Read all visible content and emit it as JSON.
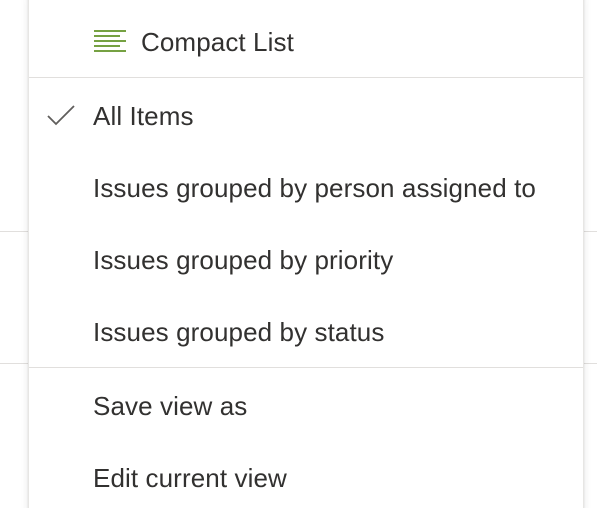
{
  "menu": {
    "view_types": [
      {
        "label": "Compact List",
        "icon": "compact-list-icon",
        "selected": false
      }
    ],
    "views": [
      {
        "label": "All Items",
        "selected": true,
        "icon": "checkmark-icon"
      },
      {
        "label": "Issues grouped by person assigned to",
        "selected": false
      },
      {
        "label": "Issues grouped by priority",
        "selected": false
      },
      {
        "label": "Issues grouped by status",
        "selected": false
      }
    ],
    "actions": [
      {
        "label": "Save view as"
      },
      {
        "label": "Edit current view"
      }
    ]
  },
  "colors": {
    "accent_green": "#498205",
    "text": "#323130",
    "divider": "#e1dfdd",
    "check": "#605e5c"
  }
}
